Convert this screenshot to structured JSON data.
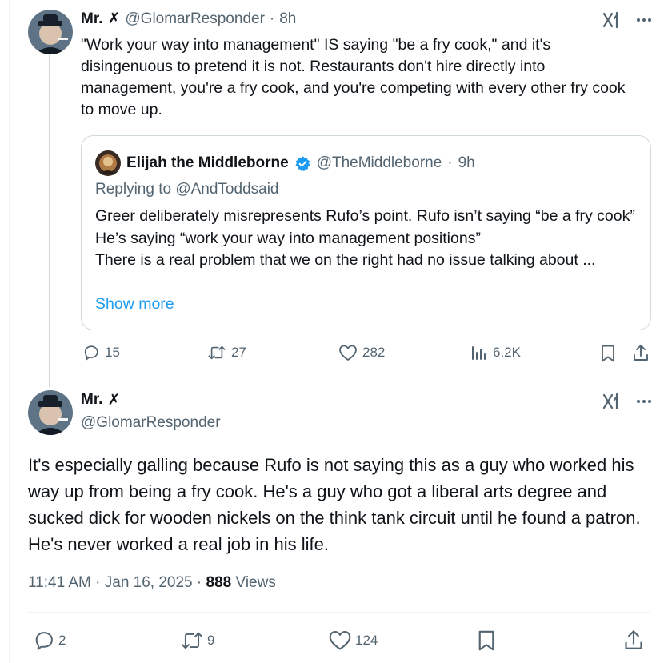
{
  "colors": {
    "text": "#0f1419",
    "muted": "#536471",
    "link": "#1d9bf0",
    "border": "#cfd9de"
  },
  "tweet1": {
    "display_name": "Mr.",
    "name_glyph": "✗",
    "handle": "@GlomarResponder",
    "time": "8h",
    "body": "\"Work your way into management\" IS saying \"be a fry cook,\" and it's disingenuous to pretend it is not. Restaurants don't hire directly into management, you're a fry cook, and you're competing with every other fry cook to move up.",
    "quote": {
      "display_name": "Elijah the Middleborne",
      "handle": "@TheMiddleborne",
      "time": "9h",
      "replying_to": "Replying to @AndToddsaid",
      "text_line1": "Greer deliberately misrepresents Rufo’s point. Rufo isn’t saying “be a fry cook”",
      "text_line2": "He’s saying “work your way into management positions”",
      "text_line3": "There is a real problem that we on the right had no issue talking about ...",
      "show_more": "Show more"
    },
    "stats": {
      "replies": "15",
      "reposts": "27",
      "likes": "282",
      "views": "6.2K"
    }
  },
  "tweet2": {
    "display_name": "Mr.",
    "name_glyph": "✗",
    "handle": "@GlomarResponder",
    "body": "It's especially galling because Rufo is not saying this as a guy who worked his way up from being a fry cook. He's a guy who got a liberal arts degree and sucked dick for wooden nickels on the think tank circuit until he found a patron. He's never worked a real job in his life.",
    "timestamp": "11:41 AM · Jan 16, 2025 · ",
    "views_count": "888",
    "views_label": " Views",
    "stats": {
      "replies": "2",
      "reposts": "9",
      "likes": "124"
    }
  },
  "icons": [
    "grok-icon",
    "more-icon",
    "reply-icon",
    "repost-icon",
    "like-icon",
    "views-icon",
    "bookmark-icon",
    "share-icon",
    "verified-icon"
  ]
}
